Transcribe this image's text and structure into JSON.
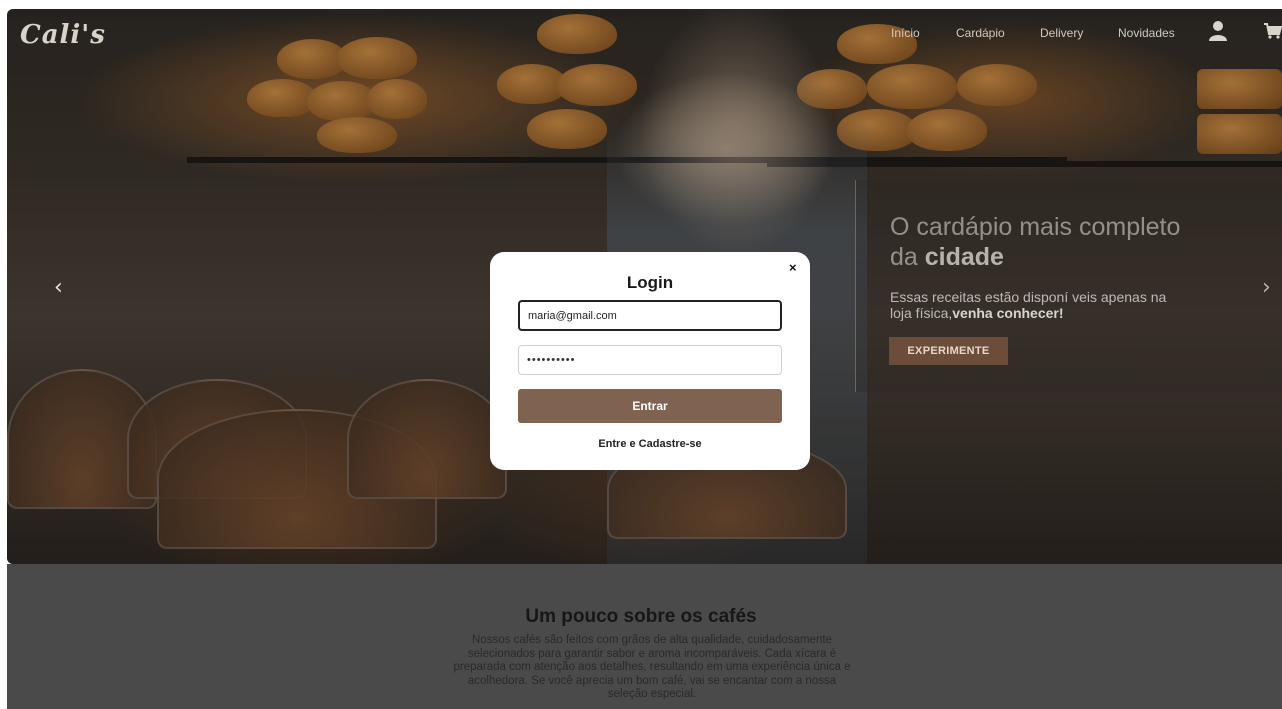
{
  "brand": {
    "logo_text": "Cali's"
  },
  "nav": {
    "items": [
      "Início",
      "Cardápio",
      "Delivery",
      "Novidades"
    ],
    "user_icon": "user-icon",
    "cart_icon": "cart-icon"
  },
  "carousel": {
    "prev_glyph": "‹",
    "next_glyph": "›"
  },
  "promo": {
    "title_prefix": "O cardápio mais completo da ",
    "title_bold": "cidade",
    "text_prefix": "Essas receitas estão disponí veis apenas na loja física,",
    "text_bold": "venha conhecer!",
    "button_label": "EXPERIMENTE"
  },
  "login_modal": {
    "title": "Login",
    "close_glyph": "×",
    "email_value": "maria@gmail.com",
    "password_value": "••••••••••",
    "submit_label": "Entrar",
    "register_link": "Entre e Cadastre-se"
  },
  "about": {
    "title": "Um pouco sobre os cafés",
    "text": "Nossos cafés são feitos com grãos de alta qualidade, cuidadosamente selecionados para garantir sabor e aroma incomparáveis. Cada xícara é preparada com atenção aos detalhes, resultando em uma experiência única e acolhedora. Se você aprecia um bom café, vai se encantar com a nossa seleção especial."
  },
  "colors": {
    "modal_button": "#7f6350",
    "promo_button": "#6b4d3a",
    "overlay": "#4a4a4a"
  }
}
